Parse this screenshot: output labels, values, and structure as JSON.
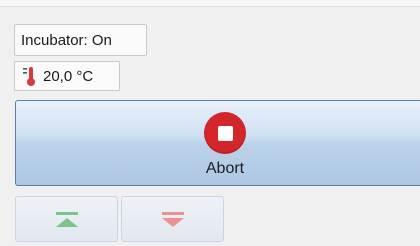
{
  "status": {
    "incubator_label": "Incubator: On",
    "temperature": "20,0 °C",
    "thermometer_icon": "thermometer-icon"
  },
  "actions": {
    "abort_label": "Abort",
    "abort_icon": "stop-icon",
    "move_up_icon": "move-to-top-icon",
    "move_down_icon": "move-to-bottom-icon"
  },
  "colors": {
    "abort_red": "#d3262b",
    "up_green": "#7cc489",
    "down_red": "#f08f8f",
    "thermometer_red": "#d83a3a"
  }
}
